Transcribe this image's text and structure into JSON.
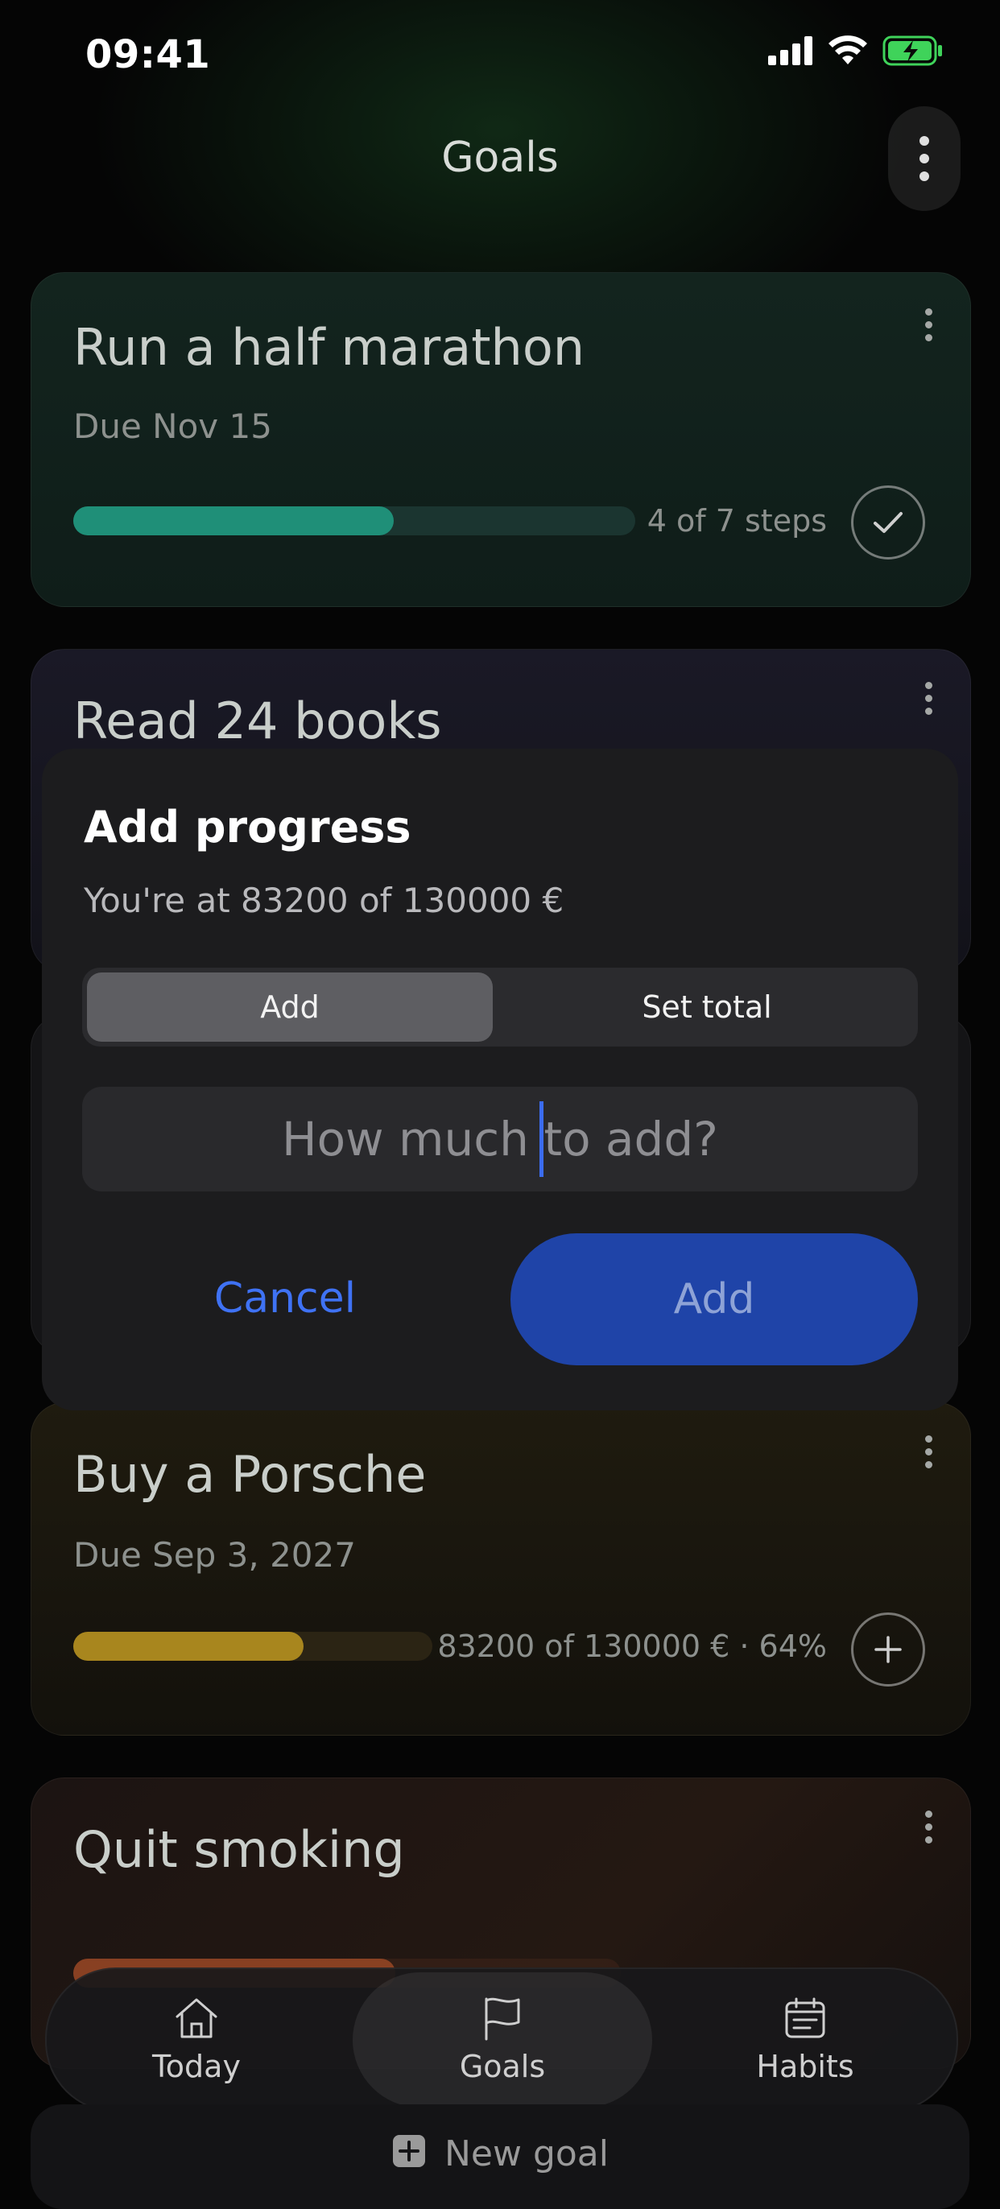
{
  "status_bar": {
    "time": "09:41"
  },
  "header": {
    "title": "Goals"
  },
  "goals": [
    {
      "title": "Run a half marathon",
      "due": "Due Nov 15",
      "progress_label": "4 of 7 steps",
      "progress": 0.57,
      "accent": "#1f8f78"
    },
    {
      "title": "Read 24 books"
    },
    {
      "title": "Buy a Porsche",
      "due": "Due Sep 3, 2027",
      "progress_label": "83200 of 130000 € · 64%",
      "progress": 0.64,
      "accent": "#a8861e"
    },
    {
      "title": "Quit smoking",
      "accent": "#b5532a"
    }
  ],
  "dialog": {
    "title": "Add progress",
    "subtitle": "You're at 83200 of 130000 €",
    "segments": {
      "add": "Add",
      "set_total": "Set total"
    },
    "input_placeholder": "How much to add?",
    "cancel_label": "Cancel",
    "add_label": "Add"
  },
  "tabbar": {
    "today": "Today",
    "goals": "Goals",
    "habits": "Habits"
  },
  "new_goal_label": "New goal",
  "colors": {
    "accent_blue": "#1f44a8",
    "link_blue": "#3f72f4"
  }
}
